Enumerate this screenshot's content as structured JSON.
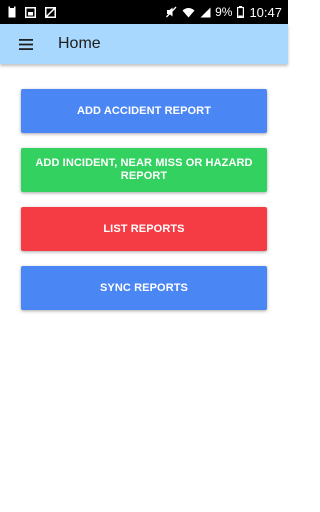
{
  "status_bar": {
    "battery_percent": "9%",
    "time": "10:47",
    "left_icons": [
      "sim-card-icon",
      "gallery-icon",
      "no-sim-icon"
    ],
    "right_icons": [
      "mute-icon",
      "wifi-icon",
      "signal-icon",
      "battery-icon"
    ]
  },
  "app_bar": {
    "title": "Home",
    "background": "#a8d8fd"
  },
  "buttons": [
    {
      "label": "ADD ACCIDENT REPORT",
      "color": "#4b86f5"
    },
    {
      "label": "ADD INCIDENT, NEAR MISS OR HAZARD REPORT",
      "color": "#33d160"
    },
    {
      "label": "LIST REPORTS",
      "color": "#f53c44"
    },
    {
      "label": "SYNC REPORTS",
      "color": "#4b86f5"
    }
  ]
}
